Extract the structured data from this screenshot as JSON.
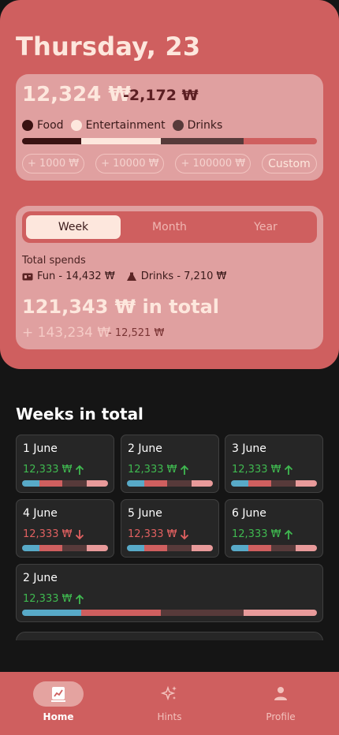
{
  "header": {
    "date_title": "Thursday, 23"
  },
  "balance_card": {
    "balance": "12,324 ₩",
    "delta": "-2,172 ₩",
    "legend": [
      {
        "label": "Food",
        "color": "#3a1212"
      },
      {
        "label": "Entertainment",
        "color": "#fde7dd"
      },
      {
        "label": "Drinks",
        "color": "#573a3a"
      }
    ],
    "split": [
      {
        "name": "Food",
        "fraction": 0.2,
        "color": "#3a1212"
      },
      {
        "name": "Entertainment",
        "fraction": 0.27,
        "color": "#fde7dd"
      },
      {
        "name": "Drinks",
        "fraction": 0.28,
        "color": "#573a3a"
      },
      {
        "name": "Rest",
        "fraction": 0.25,
        "color": "#cf5f5f"
      }
    ],
    "quick_add": [
      "+ 1000 ₩",
      "+ 10000 ₩",
      "+ 100000 ₩"
    ],
    "custom_label": "Custom"
  },
  "period_card": {
    "tabs": [
      "Week",
      "Month",
      "Year"
    ],
    "active_tab": "Week",
    "spends_label": "Total spends",
    "spend_items": [
      {
        "icon": "ticket-icon",
        "label": "Fun - 14,432 ₩"
      },
      {
        "icon": "flask-icon",
        "label": "Drinks - 7,210 ₩"
      }
    ],
    "total": "121,343 ₩ in total",
    "plus": "+ 143,234 ₩",
    "minus": "- 12,521 ₩"
  },
  "weeks": {
    "title": "Weeks in total",
    "items": [
      {
        "date": "1 June",
        "value": "12,333 ₩",
        "trend": "up"
      },
      {
        "date": "2 June",
        "value": "12,333 ₩",
        "trend": "up"
      },
      {
        "date": "3 June",
        "value": "12,333 ₩",
        "trend": "up"
      },
      {
        "date": "4 June",
        "value": "12,333 ₩",
        "trend": "down"
      },
      {
        "date": "5 June",
        "value": "12,333 ₩",
        "trend": "down"
      },
      {
        "date": "6 June",
        "value": "12,333 ₩",
        "trend": "up"
      },
      {
        "date": "2 June",
        "value": "12,333 ₩",
        "trend": "up"
      }
    ],
    "bar_split": [
      {
        "fraction": 0.2,
        "color": "#58aac8"
      },
      {
        "fraction": 0.27,
        "color": "#cf5f5f"
      },
      {
        "fraction": 0.28,
        "color": "#573a3a"
      },
      {
        "fraction": 0.25,
        "color": "#e89a9a"
      }
    ]
  },
  "nav": {
    "items": [
      {
        "label": "Home",
        "icon": "chart-icon",
        "active": true
      },
      {
        "label": "Hints",
        "icon": "sparkles-icon",
        "active": false
      },
      {
        "label": "Profile",
        "icon": "user-icon",
        "active": false
      }
    ]
  }
}
